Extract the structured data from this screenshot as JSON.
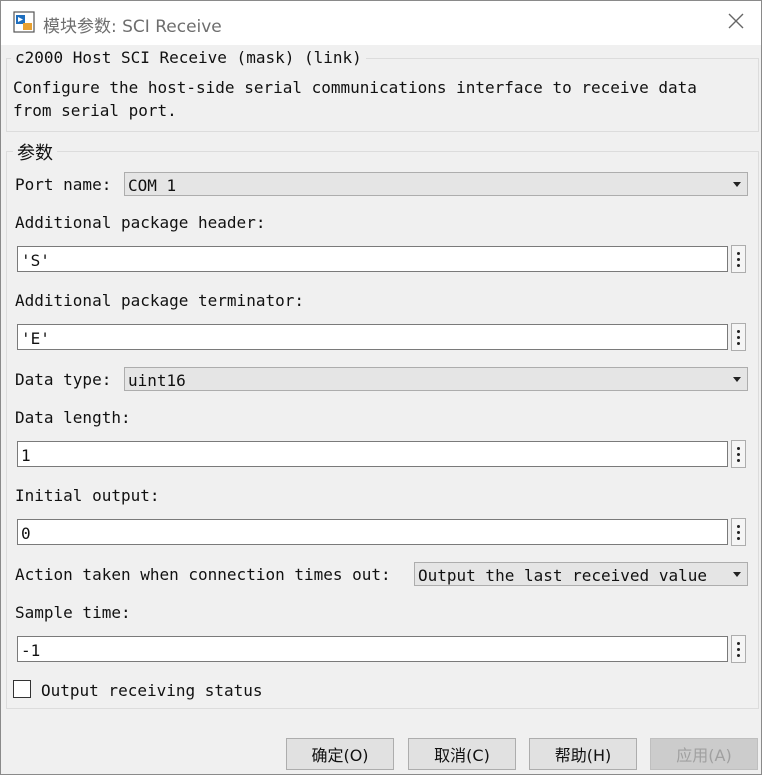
{
  "window": {
    "title": "模块参数: SCI Receive",
    "icon": "simulink-block-icon",
    "close_icon": "close-icon"
  },
  "block": {
    "header": "c2000 Host SCI Receive (mask) (link)",
    "description": "Configure the host-side serial communications interface to receive data\nfrom serial port."
  },
  "parameters": {
    "group_title": "参数",
    "port_name": {
      "label": "Port name:",
      "value": "COM 1"
    },
    "package_header": {
      "label": "Additional package header:",
      "value": "'S'"
    },
    "package_terminator": {
      "label": "Additional package terminator:",
      "value": "'E'"
    },
    "data_type": {
      "label": "Data type:",
      "value": "uint16"
    },
    "data_length": {
      "label": "Data length:",
      "value": "1"
    },
    "initial_output": {
      "label": "Initial output:",
      "value": "0"
    },
    "timeout_action": {
      "label": "Action taken when connection times out:",
      "value": "Output the last received value"
    },
    "sample_time": {
      "label": "Sample time:",
      "value": "-1"
    },
    "output_status": {
      "label": "Output receiving status",
      "checked": false
    }
  },
  "buttons": {
    "ok": "确定(O)",
    "cancel": "取消(C)",
    "help": "帮助(H)",
    "apply": "应用(A)"
  },
  "colors": {
    "background": "#f0f0f0",
    "combo_bg": "#e5e5e5",
    "button_bg": "#e1e1e1",
    "disabled_text": "#a0a0a0"
  }
}
